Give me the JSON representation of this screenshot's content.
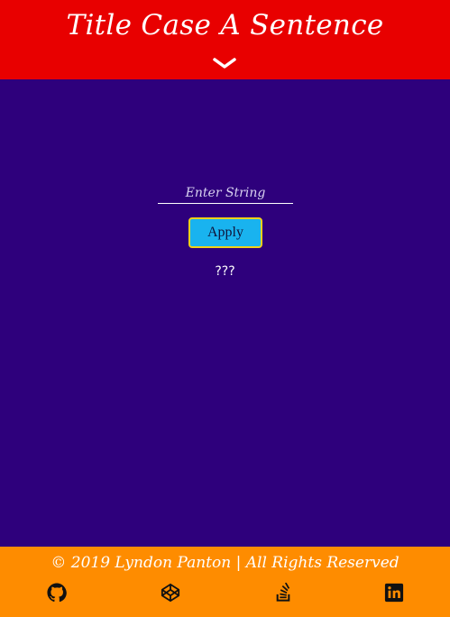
{
  "header": {
    "title": "Title Case A Sentence",
    "toggle_icon": "chevron-down-icon"
  },
  "form": {
    "input_placeholder": "Enter String",
    "input_value": "",
    "apply_label": "Apply",
    "result_text": "???"
  },
  "footer": {
    "copyright": "© 2019 Lyndon Panton | All Rights Reserved",
    "links": [
      {
        "icon": "github-icon"
      },
      {
        "icon": "codepen-icon"
      },
      {
        "icon": "stackoverflow-icon"
      },
      {
        "icon": "linkedin-icon"
      }
    ]
  },
  "colors": {
    "header_bg": "#e80000",
    "main_bg": "#2e007c",
    "footer_bg": "#fe8c00",
    "button_bg": "#19b3ef",
    "button_border": "#f2d21a"
  }
}
